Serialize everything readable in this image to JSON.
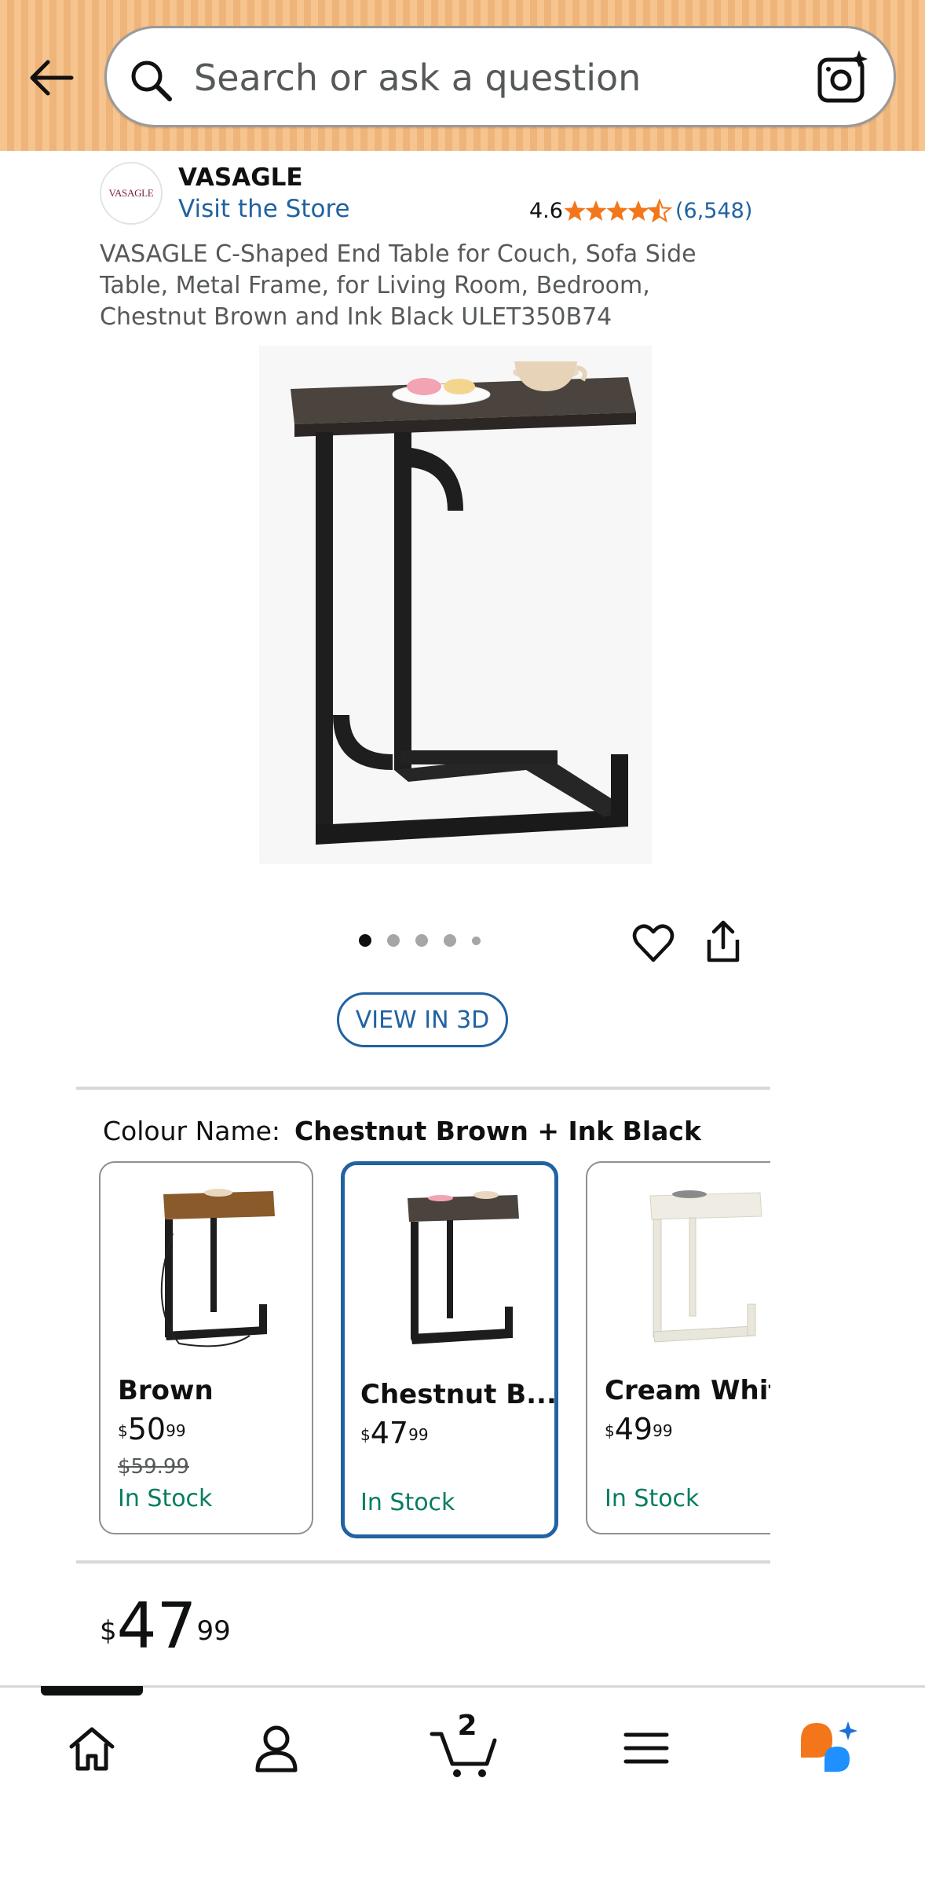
{
  "header": {
    "search_placeholder": "Search or ask a question",
    "icons": [
      "back-arrow-icon",
      "search-icon",
      "camera-icon"
    ],
    "background_color": "#F6C48F"
  },
  "brand": {
    "logo_text": "VASAGLE",
    "name": "VASAGLE",
    "visit_store": "Visit the Store",
    "rating": "4.6",
    "stars": 4.6,
    "review_count": "(6,548)",
    "star_color": "#F3761A"
  },
  "product": {
    "title": "VASAGLE C-Shaped End Table for Couch, Sofa Side Table, Metal Frame, for Living Room, Bedroom, Chestnut Brown and Ink Black ULET350B74",
    "image_count": 5,
    "active_image": 1,
    "view_3d_label": "VIEW IN 3D"
  },
  "colour": {
    "label": "Colour Name:",
    "selected": "Chestnut Brown + Ink Black",
    "options": [
      {
        "name": "Brown",
        "price_whole": "50",
        "price_frac": "99",
        "was_price": "$59.99",
        "stock": "In Stock",
        "selected": false
      },
      {
        "name": "Chestnut B...",
        "price_whole": "47",
        "price_frac": "99",
        "stock": "In Stock",
        "selected": true
      },
      {
        "name": "Cream White",
        "price_whole": "49",
        "price_frac": "99",
        "stock": "In Stock",
        "selected": false
      }
    ]
  },
  "price": {
    "currency": "$",
    "whole": "47",
    "fraction": "99"
  },
  "bottom_nav": {
    "items": [
      "home-icon",
      "account-icon",
      "cart-icon",
      "menu-icon",
      "rufus-icon"
    ],
    "cart_count": "2",
    "active": "home"
  },
  "colors": {
    "link": "#2162A1",
    "in_stock": "#067D62",
    "selected_border": "#2162A1"
  }
}
